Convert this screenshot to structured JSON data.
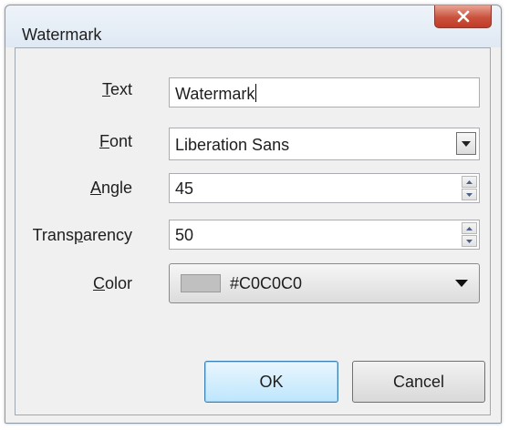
{
  "window": {
    "title": "Watermark",
    "close_label": "X"
  },
  "fields": {
    "text": {
      "label_prefix": "",
      "label_mnemonic": "T",
      "label_suffix": "ext",
      "value": "Watermark"
    },
    "font": {
      "label_prefix": "",
      "label_mnemonic": "F",
      "label_suffix": "ont",
      "value": "Liberation Sans"
    },
    "angle": {
      "label_prefix": "",
      "label_mnemonic": "A",
      "label_suffix": "ngle",
      "value": "45"
    },
    "transparency": {
      "label_prefix": "Trans",
      "label_mnemonic": "p",
      "label_suffix": "arency",
      "value": "50"
    },
    "color": {
      "label_prefix": "",
      "label_mnemonic": "C",
      "label_suffix": "olor",
      "value": "#C0C0C0",
      "swatch": "#C0C0C0"
    }
  },
  "buttons": {
    "ok": "OK",
    "cancel": "Cancel"
  },
  "icons": {
    "close": "close-x-icon",
    "font_dropdown": "chevron-down-icon",
    "spin_up": "spin-up-icon",
    "spin_down": "spin-down-icon",
    "color_dropdown": "chevron-down-icon"
  }
}
